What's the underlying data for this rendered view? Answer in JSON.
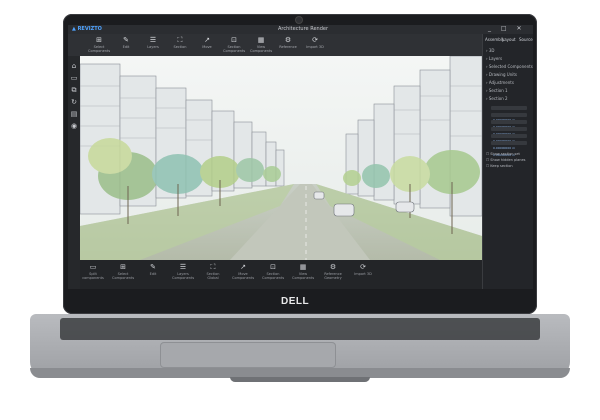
{
  "device": {
    "logo": "DELL"
  },
  "app": {
    "brand": "▲ REVIZTO",
    "title": "Architecture Render",
    "window_controls": "_ □ ✕",
    "ribbon": [
      {
        "icon": "⊞",
        "label": "Select Components"
      },
      {
        "icon": "✎",
        "label": "Edit"
      },
      {
        "icon": "☰",
        "label": "Layers"
      },
      {
        "icon": "⛶",
        "label": "Section"
      },
      {
        "icon": "↗",
        "label": "Move"
      },
      {
        "icon": "⊡",
        "label": "Section Components"
      },
      {
        "icon": "▦",
        "label": "View Components"
      },
      {
        "icon": "⚙",
        "label": "Reference"
      },
      {
        "icon": "⟳",
        "label": "Import 3D"
      }
    ],
    "left_tools": [
      "⌂",
      "▭",
      "⧉",
      "↻",
      "▤",
      "◉"
    ],
    "panel": {
      "tabs": [
        "Assembly",
        "Layout",
        "Sources"
      ],
      "rows": [
        "3D",
        "Layers",
        "Selected Components",
        "Drawing Units",
        "Adjustments",
        "Section 1",
        "Section 2"
      ],
      "chips": [
        "0.00000000 m",
        "0.00000000 m",
        "0.00000000 m",
        "0.00000000 m",
        "0.00000000 m",
        "0.00000000 m"
      ],
      "footer": [
        "Show section set",
        "Show hidden planes",
        "Keep section"
      ]
    },
    "bottom": [
      {
        "icon": "▭",
        "label": "Split components"
      },
      {
        "icon": "⊞",
        "label": "Select Components"
      },
      {
        "icon": "✎",
        "label": "Edit"
      },
      {
        "icon": "☰",
        "label": "Layers Components"
      },
      {
        "icon": "⛶",
        "label": "Section Global"
      },
      {
        "icon": "↗",
        "label": "Move Components"
      },
      {
        "icon": "⊡",
        "label": "Section Components"
      },
      {
        "icon": "▦",
        "label": "View Components"
      },
      {
        "icon": "⚙",
        "label": "Reference Geometry"
      },
      {
        "icon": "⟳",
        "label": "Import 3D"
      }
    ]
  }
}
